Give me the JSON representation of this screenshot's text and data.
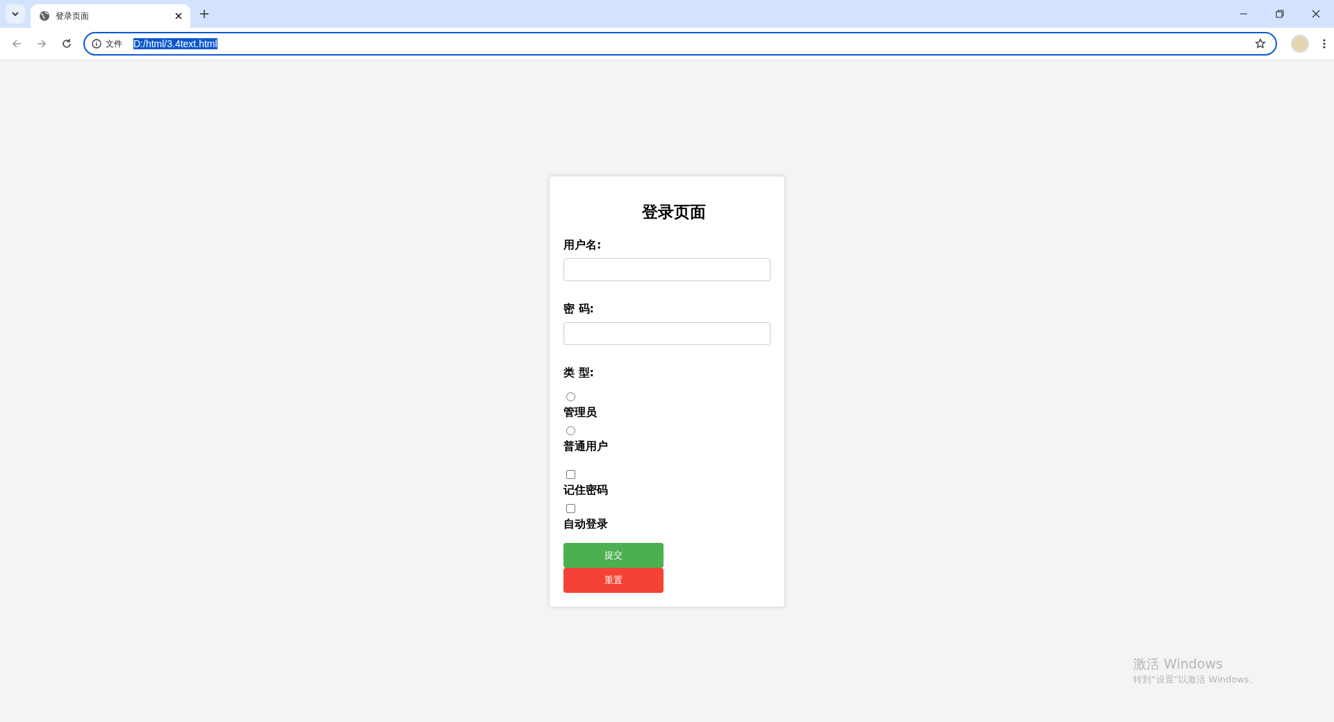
{
  "browser": {
    "tab": {
      "title": "登录页面"
    },
    "address_bar": {
      "security_label": "文件",
      "url": "D:/html/3.4text.html"
    }
  },
  "form": {
    "title": "登录页面",
    "fields": [
      {
        "label": "用户名:"
      },
      {
        "label": "密 码:"
      }
    ],
    "type_label": "类 型:",
    "radios": [
      {
        "label": "管理员",
        "selected": false
      },
      {
        "label": "普通用户",
        "selected": false
      }
    ],
    "checkboxes": [
      {
        "label": "记住密码",
        "checked": false
      },
      {
        "label": "自动登录",
        "checked": false
      }
    ],
    "buttons": [
      {
        "label": "提交",
        "kind": "submit"
      },
      {
        "label": "重置",
        "kind": "reset"
      }
    ]
  },
  "os_notice": {
    "title": "激活 Windows",
    "subtitle": "转到“设置”以激活 Windows。"
  }
}
